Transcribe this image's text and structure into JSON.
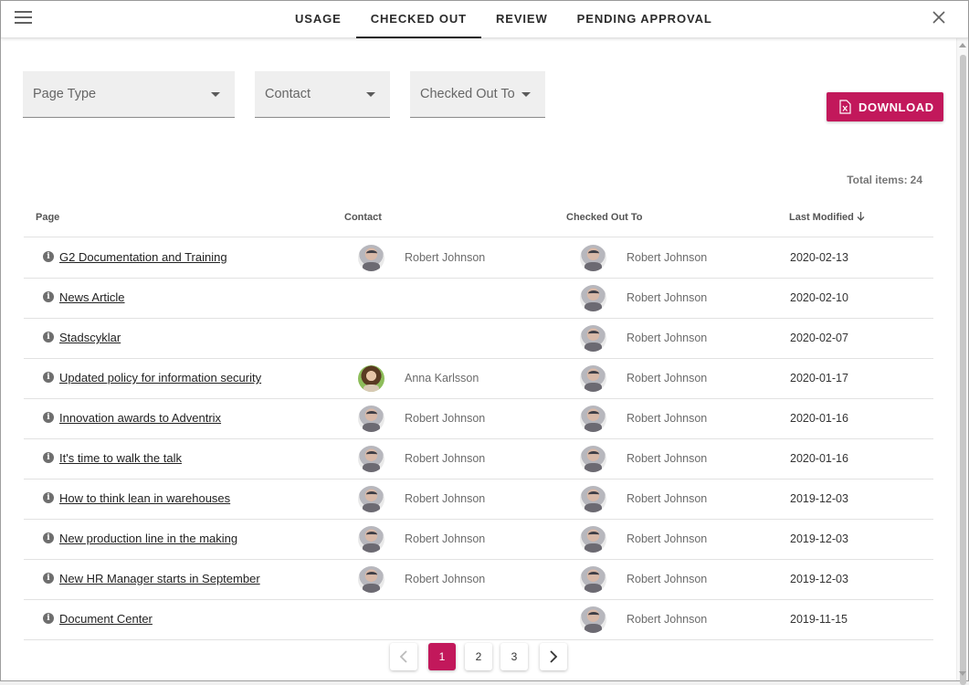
{
  "header": {
    "tabs": [
      {
        "label": "USAGE"
      },
      {
        "label": "CHECKED OUT"
      },
      {
        "label": "REVIEW"
      },
      {
        "label": "PENDING APPROVAL"
      }
    ],
    "active_tab": "CHECKED OUT"
  },
  "filters": {
    "page_type": {
      "label": "Page Type"
    },
    "contact": {
      "label": "Contact"
    },
    "checked_out_to": {
      "label": "Checked Out To"
    }
  },
  "download": {
    "label": "DOWNLOAD",
    "icon": "excel-file-icon"
  },
  "total": {
    "label": "Total items:",
    "count": "24"
  },
  "table": {
    "columns": {
      "page": "Page",
      "contact": "Contact",
      "checked_out_to": "Checked Out To",
      "last_modified": "Last Modified"
    },
    "sort": {
      "column": "Last Modified",
      "direction": "descending"
    },
    "rows": [
      {
        "page": "G2 Documentation and Training",
        "contact": "Robert Johnson",
        "checked_out_to": "Robert Johnson",
        "last_modified": "2020-02-13"
      },
      {
        "page": "News Article",
        "contact": "",
        "checked_out_to": "Robert Johnson",
        "last_modified": "2020-02-10"
      },
      {
        "page": "Stadscyklar",
        "contact": "",
        "checked_out_to": "Robert Johnson",
        "last_modified": "2020-02-07"
      },
      {
        "page": "Updated policy for information security",
        "contact": "Anna Karlsson",
        "checked_out_to": "Robert Johnson",
        "last_modified": "2020-01-17"
      },
      {
        "page": "Innovation awards to Adventrix",
        "contact": "Robert Johnson",
        "checked_out_to": "Robert Johnson",
        "last_modified": "2020-01-16"
      },
      {
        "page": "It's time to walk the talk",
        "contact": "Robert Johnson",
        "checked_out_to": "Robert Johnson",
        "last_modified": "2020-01-16"
      },
      {
        "page": "How to think lean in warehouses",
        "contact": "Robert Johnson",
        "checked_out_to": "Robert Johnson",
        "last_modified": "2019-12-03"
      },
      {
        "page": "New production line in the making",
        "contact": "Robert Johnson",
        "checked_out_to": "Robert Johnson",
        "last_modified": "2019-12-03"
      },
      {
        "page": "New HR Manager starts in September",
        "contact": "Robert Johnson",
        "checked_out_to": "Robert Johnson",
        "last_modified": "2019-12-03"
      },
      {
        "page": "Document Center",
        "contact": "",
        "checked_out_to": "Robert Johnson",
        "last_modified": "2019-11-15"
      }
    ]
  },
  "pagination": {
    "pages": [
      "1",
      "2",
      "3"
    ],
    "current": "1"
  },
  "colors": {
    "accent": "#c2185b"
  }
}
